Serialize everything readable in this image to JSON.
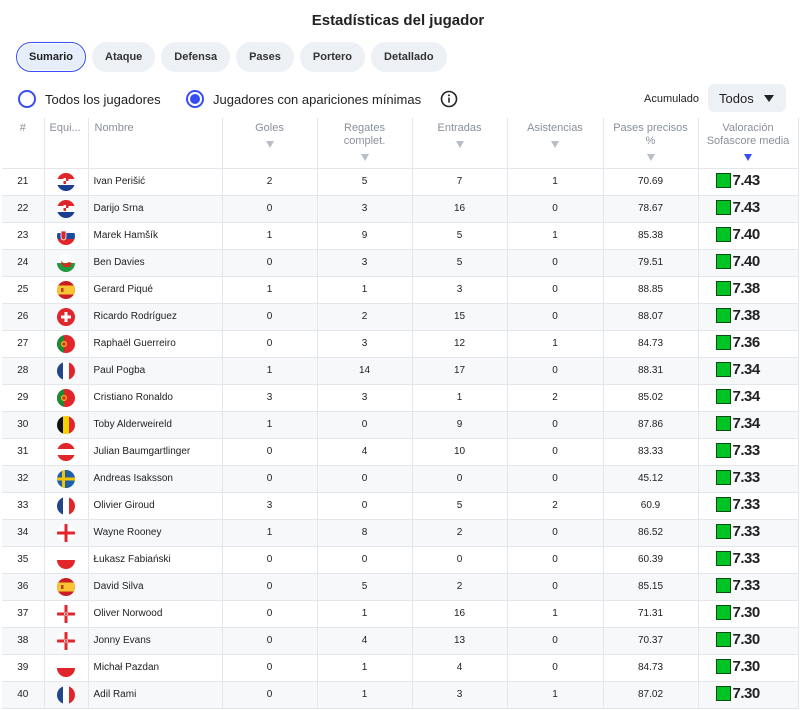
{
  "title": "Estadísticas del jugador",
  "tabs": [
    {
      "label": "Sumario",
      "active": true
    },
    {
      "label": "Ataque",
      "active": false
    },
    {
      "label": "Defensa",
      "active": false
    },
    {
      "label": "Pases",
      "active": false
    },
    {
      "label": "Portero",
      "active": false
    },
    {
      "label": "Detallado",
      "active": false
    }
  ],
  "filters": {
    "all_players": {
      "label": "Todos los jugadores",
      "selected": false
    },
    "min_apps": {
      "label": "Jugadores con apariciones mínimas",
      "selected": true
    },
    "info_icon": "info-icon",
    "accumulated_label": "Acumulado",
    "select_value": "Todos"
  },
  "columns": {
    "rank": "#",
    "team": "Equi...",
    "name": "Nombre",
    "goals": "Goles",
    "dribbles": "Regates complet.",
    "tackles": "Entradas",
    "assists": "Asistencias",
    "pass_pct": "Pases precisos %",
    "rating": "Valoración Sofascore media"
  },
  "colors": {
    "accent": "#374df5",
    "rating_green": "#00c424"
  },
  "rows": [
    {
      "rank": "21",
      "flag": "croatia",
      "name": "Ivan Perišić",
      "goals": "2",
      "dribbles": "5",
      "tackles": "7",
      "assists": "1",
      "pass_pct": "70.69",
      "rating": "7.43"
    },
    {
      "rank": "22",
      "flag": "croatia",
      "name": "Darijo Srna",
      "goals": "0",
      "dribbles": "3",
      "tackles": "16",
      "assists": "0",
      "pass_pct": "78.67",
      "rating": "7.43"
    },
    {
      "rank": "23",
      "flag": "slovakia",
      "name": "Marek Hamšík",
      "goals": "1",
      "dribbles": "9",
      "tackles": "5",
      "assists": "1",
      "pass_pct": "85.38",
      "rating": "7.40"
    },
    {
      "rank": "24",
      "flag": "wales",
      "name": "Ben Davies",
      "goals": "0",
      "dribbles": "3",
      "tackles": "5",
      "assists": "0",
      "pass_pct": "79.51",
      "rating": "7.40"
    },
    {
      "rank": "25",
      "flag": "spain",
      "name": "Gerard Piqué",
      "goals": "1",
      "dribbles": "1",
      "tackles": "3",
      "assists": "0",
      "pass_pct": "88.85",
      "rating": "7.38"
    },
    {
      "rank": "26",
      "flag": "switzerland",
      "name": "Ricardo Rodríguez",
      "goals": "0",
      "dribbles": "2",
      "tackles": "15",
      "assists": "0",
      "pass_pct": "88.07",
      "rating": "7.38"
    },
    {
      "rank": "27",
      "flag": "portugal",
      "name": "Raphaël Guerreiro",
      "goals": "0",
      "dribbles": "3",
      "tackles": "12",
      "assists": "1",
      "pass_pct": "84.73",
      "rating": "7.36"
    },
    {
      "rank": "28",
      "flag": "france",
      "name": "Paul Pogba",
      "goals": "1",
      "dribbles": "14",
      "tackles": "17",
      "assists": "0",
      "pass_pct": "88.31",
      "rating": "7.34"
    },
    {
      "rank": "29",
      "flag": "portugal",
      "name": "Cristiano Ronaldo",
      "goals": "3",
      "dribbles": "3",
      "tackles": "1",
      "assists": "2",
      "pass_pct": "85.02",
      "rating": "7.34"
    },
    {
      "rank": "30",
      "flag": "belgium",
      "name": "Toby Alderweireld",
      "goals": "1",
      "dribbles": "0",
      "tackles": "9",
      "assists": "0",
      "pass_pct": "87.86",
      "rating": "7.34"
    },
    {
      "rank": "31",
      "flag": "austria",
      "name": "Julian Baumgartlinger",
      "goals": "0",
      "dribbles": "4",
      "tackles": "10",
      "assists": "0",
      "pass_pct": "83.33",
      "rating": "7.33"
    },
    {
      "rank": "32",
      "flag": "sweden",
      "name": "Andreas Isaksson",
      "goals": "0",
      "dribbles": "0",
      "tackles": "0",
      "assists": "0",
      "pass_pct": "45.12",
      "rating": "7.33"
    },
    {
      "rank": "33",
      "flag": "france",
      "name": "Olivier Giroud",
      "goals": "3",
      "dribbles": "0",
      "tackles": "5",
      "assists": "2",
      "pass_pct": "60.9",
      "rating": "7.33"
    },
    {
      "rank": "34",
      "flag": "england",
      "name": "Wayne Rooney",
      "goals": "1",
      "dribbles": "8",
      "tackles": "2",
      "assists": "0",
      "pass_pct": "86.52",
      "rating": "7.33"
    },
    {
      "rank": "35",
      "flag": "poland",
      "name": "Łukasz Fabiański",
      "goals": "0",
      "dribbles": "0",
      "tackles": "0",
      "assists": "0",
      "pass_pct": "60.39",
      "rating": "7.33"
    },
    {
      "rank": "36",
      "flag": "spain",
      "name": "David Silva",
      "goals": "0",
      "dribbles": "5",
      "tackles": "2",
      "assists": "0",
      "pass_pct": "85.15",
      "rating": "7.33"
    },
    {
      "rank": "37",
      "flag": "northern-ireland",
      "name": "Oliver Norwood",
      "goals": "0",
      "dribbles": "1",
      "tackles": "16",
      "assists": "1",
      "pass_pct": "71.31",
      "rating": "7.30"
    },
    {
      "rank": "38",
      "flag": "northern-ireland",
      "name": "Jonny Evans",
      "goals": "0",
      "dribbles": "4",
      "tackles": "13",
      "assists": "0",
      "pass_pct": "70.37",
      "rating": "7.30"
    },
    {
      "rank": "39",
      "flag": "poland",
      "name": "Michał Pazdan",
      "goals": "0",
      "dribbles": "1",
      "tackles": "4",
      "assists": "0",
      "pass_pct": "84.73",
      "rating": "7.30"
    },
    {
      "rank": "40",
      "flag": "france",
      "name": "Adil Rami",
      "goals": "0",
      "dribbles": "1",
      "tackles": "3",
      "assists": "1",
      "pass_pct": "87.02",
      "rating": "7.30"
    }
  ]
}
